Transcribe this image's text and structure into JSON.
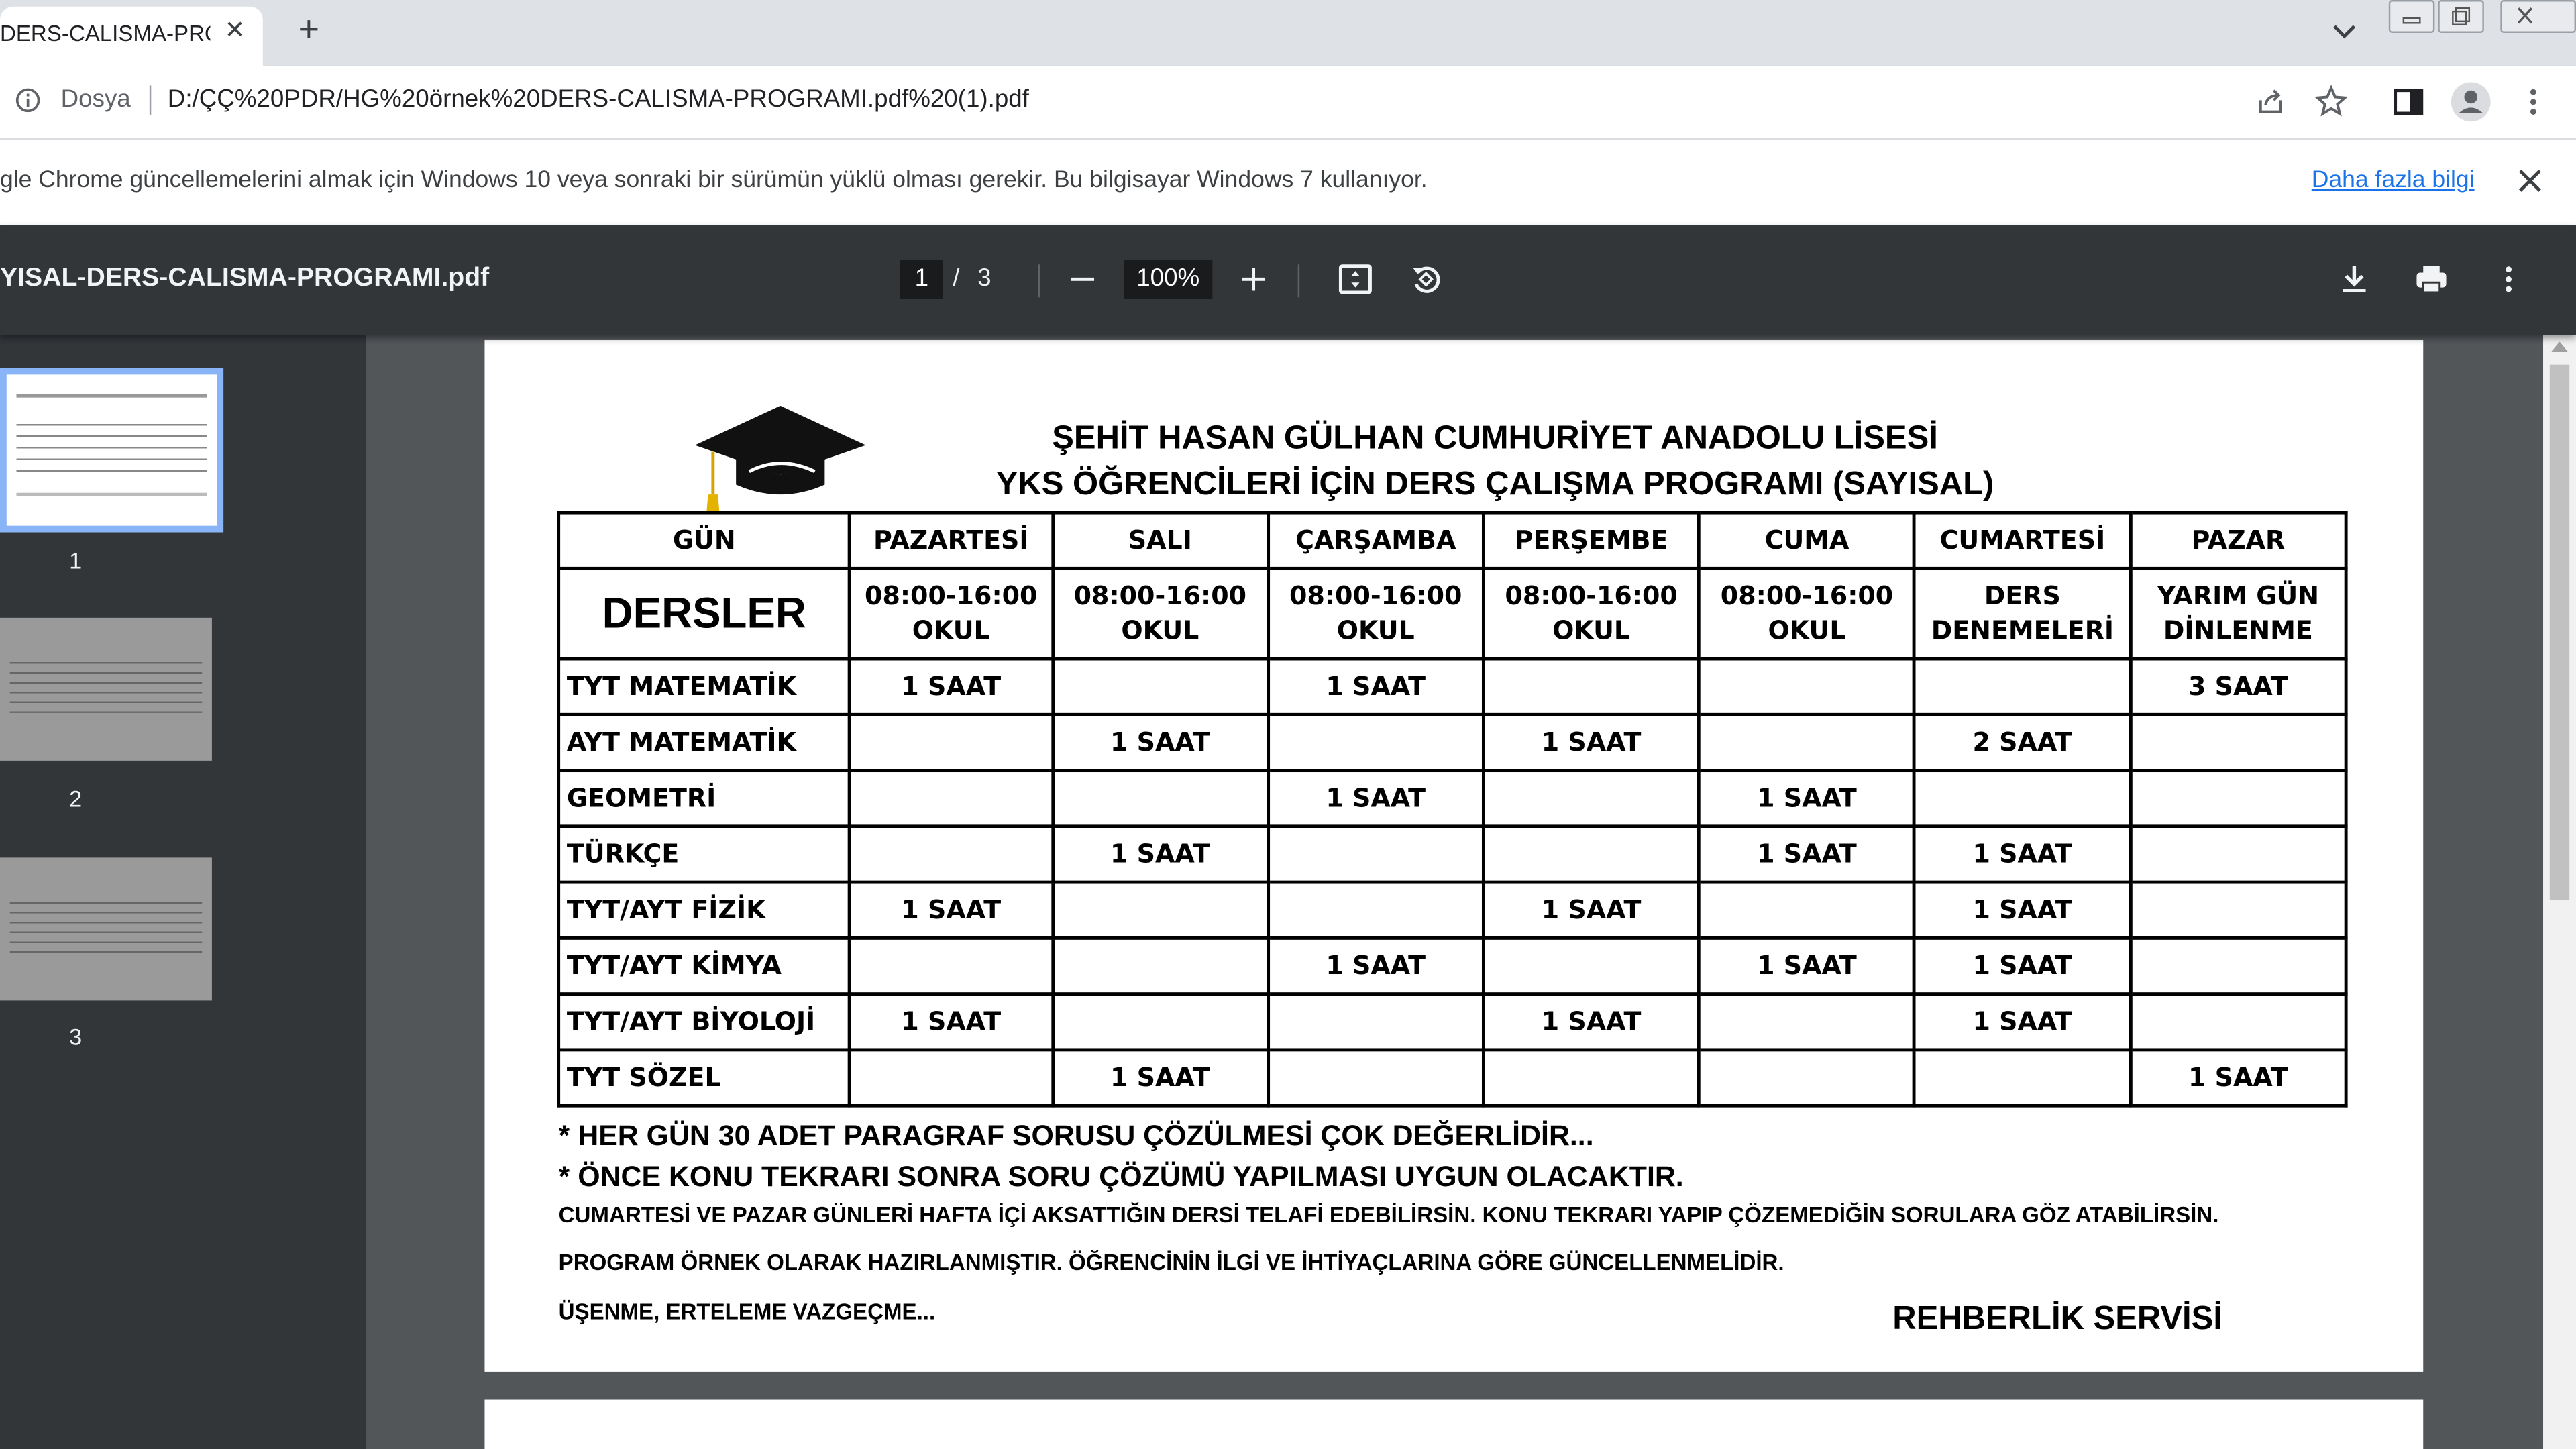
{
  "browser": {
    "tab_title": "DERS-CALISMA-PRO",
    "scheme_label": "Dosya",
    "url": "D:/ÇÇ%20PDR/HG%20örnek%20DERS-CALISMA-PROGRAMI.pdf%20(1).pdf",
    "infobar_text": "gle Chrome güncellemelerini almak için Windows 10 veya sonraki bir sürümün yüklü olması gerekir. Bu bilgisayar Windows 7 kullanıyor.",
    "infobar_link": "Daha fazla bilgi"
  },
  "pdf_viewer": {
    "file_title": "YISAL-DERS-CALISMA-PROGRAMI.pdf",
    "current_page": "1",
    "slash": "/",
    "total_pages": "3",
    "zoom": "100%",
    "thumbnails": [
      {
        "label": "1",
        "selected": true
      },
      {
        "label": "2",
        "selected": false
      },
      {
        "label": "3",
        "selected": false
      }
    ]
  },
  "document": {
    "title_line1": "ŞEHİT HASAN GÜLHAN CUMHURİYET ANADOLU LİSESİ",
    "title_line2": "YKS ÖĞRENCİLERİ İÇİN DERS ÇALIŞMA PROGRAMI (SAYISAL)",
    "table": {
      "header": [
        "GÜN",
        "PAZARTESİ",
        "SALI",
        "ÇARŞAMBA",
        "PERŞEMBE",
        "CUMA",
        "CUMARTESİ",
        "PAZAR"
      ],
      "row_label": "DERSLER",
      "time_row": [
        [
          "08:00-16:00",
          "OKUL"
        ],
        [
          "08:00-16:00",
          "OKUL"
        ],
        [
          "08:00-16:00",
          "OKUL"
        ],
        [
          "08:00-16:00",
          "OKUL"
        ],
        [
          "08:00-16:00",
          "OKUL"
        ],
        [
          "DERS",
          "DENEMELERİ"
        ],
        [
          "YARIM GÜN",
          "DİNLENME"
        ]
      ],
      "rows": [
        {
          "subject": "TYT MATEMATİK",
          "cells": [
            "1 SAAT",
            "",
            "1 SAAT",
            "",
            "",
            "",
            "3 SAAT"
          ]
        },
        {
          "subject": "AYT MATEMATİK",
          "cells": [
            "",
            "1 SAAT",
            "",
            "1 SAAT",
            "",
            "2 SAAT",
            ""
          ]
        },
        {
          "subject": "GEOMETRİ",
          "cells": [
            "",
            "",
            "1 SAAT",
            "",
            "1 SAAT",
            "",
            ""
          ]
        },
        {
          "subject": "TÜRKÇE",
          "cells": [
            "",
            "1 SAAT",
            "",
            "",
            "1 SAAT",
            "1 SAAT",
            ""
          ]
        },
        {
          "subject": "TYT/AYT FİZİK",
          "cells": [
            "1 SAAT",
            "",
            "",
            "1 SAAT",
            "",
            "1 SAAT",
            ""
          ]
        },
        {
          "subject": "TYT/AYT KİMYA",
          "cells": [
            "",
            "",
            "1 SAAT",
            "",
            "1 SAAT",
            "1 SAAT",
            ""
          ]
        },
        {
          "subject": "TYT/AYT BİYOLOJİ",
          "cells": [
            "1 SAAT",
            "",
            "",
            "1 SAAT",
            "",
            "1 SAAT",
            ""
          ]
        },
        {
          "subject": "TYT SÖZEL",
          "cells": [
            "",
            "1 SAAT",
            "",
            "",
            "",
            "",
            "1 SAAT"
          ]
        }
      ]
    },
    "note1": "* HER GÜN 30 ADET PARAGRAF SORUSU ÇÖZÜLMESİ ÇOK DEĞERLİDİR...",
    "note2": "* ÖNCE KONU TEKRARI SONRA SORU ÇÖZÜMÜ YAPILMASI UYGUN OLACAKTIR.",
    "note3": "CUMARTESİ VE PAZAR GÜNLERİ HAFTA İÇİ AKSATTIĞIN DERSİ TELAFİ  EDEBİLİRSİN. KONU TEKRARI YAPIP ÇÖZEMEDİĞİN SORULARA GÖZ ATABİLİRSİN.",
    "note4": "PROGRAM ÖRNEK OLARAK HAZIRLANMIŞTIR. ÖĞRENCİNİN İLGİ VE İHTİYAÇLARINA GÖRE GÜNCELLENMELİDİR.",
    "note5": "ÜŞENME, ERTELEME VAZGEÇME...",
    "signature": "REHBERLİK SERVİSİ"
  },
  "icons": {
    "info": "info-icon",
    "share": "share-icon",
    "bookmark": "star-icon",
    "sidepanel": "side-panel-icon",
    "profile": "profile-icon",
    "menu": "kebab-menu-icon",
    "download": "download-icon",
    "print": "print-icon",
    "fit": "fit-to-page-icon",
    "rotate": "rotate-icon"
  },
  "colors": {
    "link": "#1a73e8",
    "pdf_toolbar": "#323639",
    "viewer_bg": "#525659",
    "thumb_selected": "#8ab4f8"
  }
}
